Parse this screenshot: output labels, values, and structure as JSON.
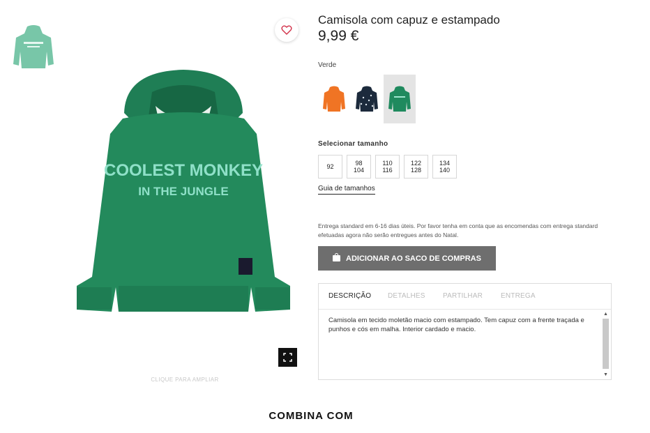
{
  "product": {
    "title": "Camisola com capuz e estampado",
    "price": "9,99 €",
    "graphic_text_line1": "COOLEST MONKEY",
    "graphic_text_line2": "IN THE JUNGLE"
  },
  "image": {
    "zoom_hint": "CLIQUE PARA AMPLIAR"
  },
  "colors": {
    "selected_label": "Verde",
    "swatches": [
      {
        "name": "orange",
        "hex": "#f07424",
        "selected": false
      },
      {
        "name": "navy",
        "hex": "#1c2a3c",
        "selected": false
      },
      {
        "name": "green",
        "hex": "#1f8a5e",
        "selected": true
      }
    ]
  },
  "sizes": {
    "label": "Selecionar tamanho",
    "options": [
      {
        "line1": "92",
        "line2": ""
      },
      {
        "line1": "98",
        "line2": "104"
      },
      {
        "line1": "110",
        "line2": "116"
      },
      {
        "line1": "122",
        "line2": "128"
      },
      {
        "line1": "134",
        "line2": "140"
      }
    ],
    "guide_label": "Guia de tamanhos"
  },
  "delivery_text": "Entrega standard em 6-16 dias úteis. Por favor tenha em conta que as encomendas com entrega standard efetuadas agora não serão entregues antes do Natal.",
  "cart": {
    "add_label": "ADICIONAR AO SACO DE COMPRAS"
  },
  "tabs": {
    "items": [
      "DESCRIÇÃO",
      "DETALHES",
      "PARTILHAR",
      "ENTREGA"
    ],
    "active": 0,
    "description": "Camisola em tecido moletão macio com estampado. Tem capuz com a frente traçada e punhos e cós em malha. Interior cardado e macio."
  },
  "section": {
    "combina_title": "COMBINA COM"
  },
  "theme": {
    "hoodie_green": "#238a5c",
    "print_mint": "#8fe0c8",
    "button_gray": "#6e6e6e"
  }
}
